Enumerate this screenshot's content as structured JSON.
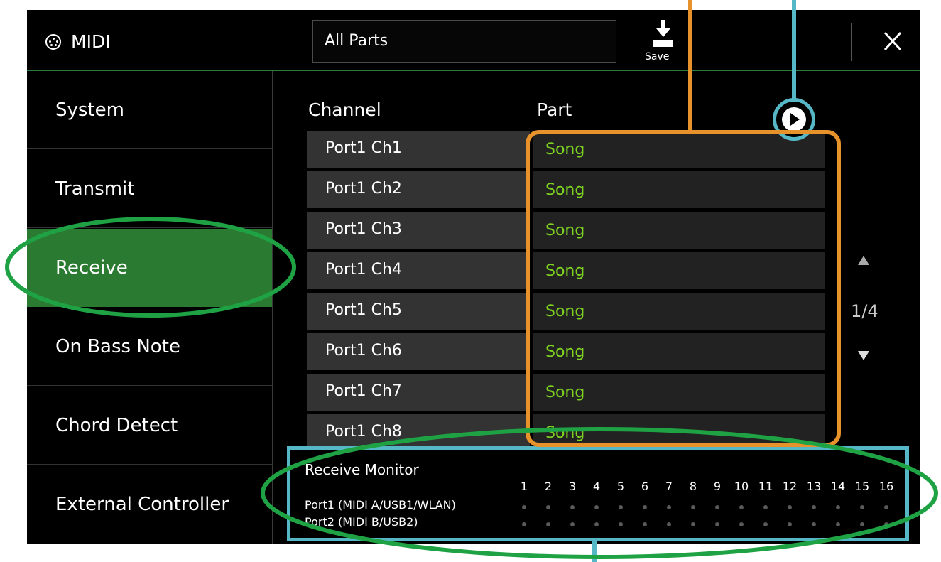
{
  "header": {
    "title": "MIDI",
    "part_select_value": "All Parts",
    "save_label": "Save"
  },
  "sidebar": {
    "items": [
      {
        "label": "System"
      },
      {
        "label": "Transmit"
      },
      {
        "label": "Receive",
        "active": true
      },
      {
        "label": "On Bass Note"
      },
      {
        "label": "Chord Detect"
      },
      {
        "label": "External Controller"
      }
    ]
  },
  "table": {
    "columns": [
      "Channel",
      "Part"
    ],
    "rows": [
      {
        "channel": "Port1 Ch1",
        "part": "Song"
      },
      {
        "channel": "Port1 Ch2",
        "part": "Song"
      },
      {
        "channel": "Port1 Ch3",
        "part": "Song"
      },
      {
        "channel": "Port1 Ch4",
        "part": "Song"
      },
      {
        "channel": "Port1 Ch5",
        "part": "Song"
      },
      {
        "channel": "Port1 Ch6",
        "part": "Song"
      },
      {
        "channel": "Port1 Ch7",
        "part": "Song"
      },
      {
        "channel": "Port1 Ch8",
        "part": "Song"
      }
    ]
  },
  "pager": {
    "page": "1/4"
  },
  "monitor": {
    "title": "Receive Monitor",
    "channels": [
      "1",
      "2",
      "3",
      "4",
      "5",
      "6",
      "7",
      "8",
      "9",
      "10",
      "11",
      "12",
      "13",
      "14",
      "15",
      "16"
    ],
    "ports": [
      {
        "label": "Port1 (MIDI A/USB1/WLAN)"
      },
      {
        "label": "Port2 (MIDI B/USB2)"
      }
    ]
  },
  "colors": {
    "active_tab": "#2a7a31",
    "part_text": "#7ed321",
    "annotation_green": "#1fa244",
    "annotation_orange": "#e8922c",
    "annotation_cyan": "#56b8c7"
  }
}
